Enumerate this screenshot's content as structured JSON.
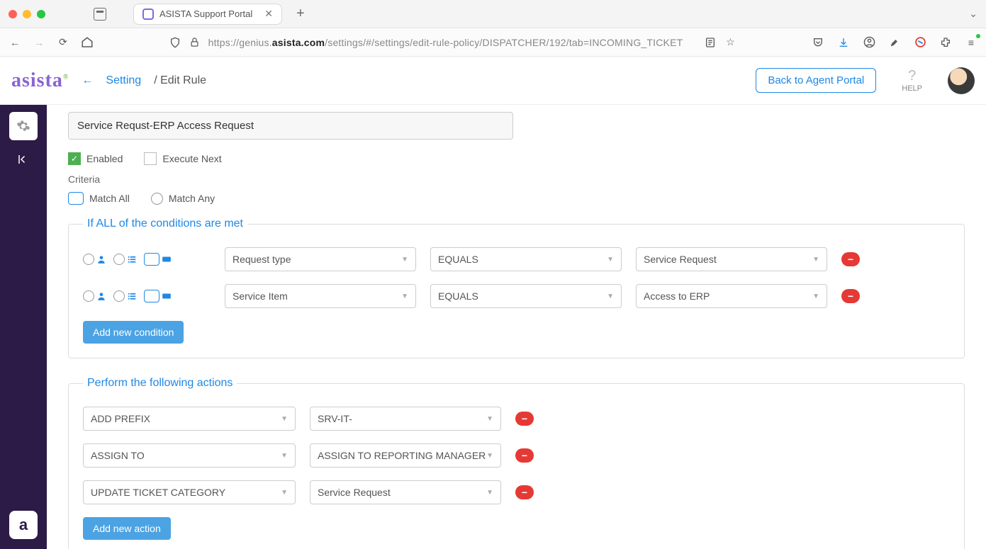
{
  "browser": {
    "tab_title": "ASISTA Support Portal",
    "url_prefix": "https://genius.",
    "url_bold": "asista.com",
    "url_suffix": "/settings/#/settings/edit-rule-policy/DISPATCHER/192/tab=INCOMING_TICKET"
  },
  "header": {
    "logo": "asista",
    "bc_link": "Setting",
    "bc_current": "/ Edit Rule",
    "back_btn": "Back to Agent Portal",
    "help": "HELP"
  },
  "form": {
    "rule_name": "Service Requst-ERP Access Request",
    "enabled_label": "Enabled",
    "execute_next_label": "Execute Next",
    "criteria_label": "Criteria",
    "match_all": "Match All",
    "match_any": "Match Any",
    "conditions_legend": "If ALL of the conditions are met",
    "conditions": [
      {
        "field": "Request type",
        "op": "EQUALS",
        "value": "Service Request"
      },
      {
        "field": "Service Item",
        "op": "EQUALS",
        "value": "Access to ERP"
      }
    ],
    "add_condition": "Add new condition",
    "actions_legend": "Perform the following actions",
    "actions": [
      {
        "type": "ADD PREFIX",
        "value": "SRV-IT-"
      },
      {
        "type": "ASSIGN TO",
        "value": "ASSIGN TO REPORTING MANAGER"
      },
      {
        "type": "UPDATE TICKET CATEGORY",
        "value": "Service Request"
      }
    ],
    "add_action": "Add new action"
  }
}
